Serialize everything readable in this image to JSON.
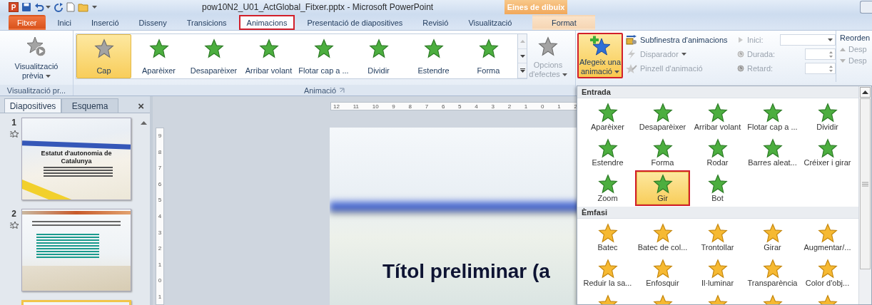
{
  "window": {
    "app_letter": "P",
    "title": "pow10N2_U01_ActGlobal_Fitxer.pptx - Microsoft PowerPoint",
    "context_group": "Eines de dibuix"
  },
  "tabs": [
    {
      "label": "Fitxer",
      "kind": "file",
      "selected": false,
      "highlighted": false
    },
    {
      "label": "Inici",
      "kind": "normal",
      "selected": false,
      "highlighted": false
    },
    {
      "label": "Inserció",
      "kind": "normal",
      "selected": false,
      "highlighted": false
    },
    {
      "label": "Disseny",
      "kind": "normal",
      "selected": false,
      "highlighted": false
    },
    {
      "label": "Transicions",
      "kind": "normal",
      "selected": false,
      "highlighted": false
    },
    {
      "label": "Animacions",
      "kind": "normal",
      "selected": true,
      "highlighted": true
    },
    {
      "label": "Presentació de diapositives",
      "kind": "normal",
      "selected": false,
      "highlighted": false
    },
    {
      "label": "Revisió",
      "kind": "normal",
      "selected": false,
      "highlighted": false
    },
    {
      "label": "Visualització",
      "kind": "normal",
      "selected": false,
      "highlighted": false
    },
    {
      "label": "Format",
      "kind": "context",
      "selected": false,
      "highlighted": false
    }
  ],
  "ribbon": {
    "preview": {
      "label_line_1": "Visualització",
      "label_line_2": "prèvia",
      "group_label": "Visualització pr..."
    },
    "gallery": {
      "group_label": "Animació",
      "items": [
        {
          "label": "Cap",
          "kind": "none",
          "selected": true
        },
        {
          "label": "Aparèixer",
          "kind": "entrance",
          "selected": false
        },
        {
          "label": "Desaparèixer",
          "kind": "entrance",
          "selected": false
        },
        {
          "label": "Arribar volant",
          "kind": "entrance",
          "selected": false
        },
        {
          "label": "Flotar cap a ...",
          "kind": "entrance",
          "selected": false
        },
        {
          "label": "Dividir",
          "kind": "entrance",
          "selected": false
        },
        {
          "label": "Estendre",
          "kind": "entrance",
          "selected": false
        },
        {
          "label": "Forma",
          "kind": "entrance",
          "selected": false
        }
      ]
    },
    "effect_options": {
      "label_line_1": "Opcions",
      "label_line_2": "d'efectes",
      "disabled": true
    },
    "add_animation": {
      "label_line_1": "Afegeix una",
      "label_line_2": "animació",
      "selected": true,
      "highlighted": true
    },
    "small_buttons": [
      {
        "label": "Subfinestra d'animacions",
        "disabled": false,
        "dropdown": false
      },
      {
        "label": "Disparador",
        "disabled": true,
        "dropdown": true
      },
      {
        "label": "Pinzell d'animació",
        "disabled": true,
        "dropdown": false
      }
    ],
    "timing": [
      {
        "label": "Inici:",
        "kind": "dropdown",
        "disabled": true
      },
      {
        "label": "Durada:",
        "kind": "spinner",
        "disabled": true
      },
      {
        "label": "Retard:",
        "kind": "spinner",
        "disabled": true
      }
    ],
    "reorder": {
      "label": "Reorden",
      "items": [
        {
          "label": "Desp",
          "kind": "up",
          "disabled": true
        },
        {
          "label": "Desp",
          "kind": "down",
          "disabled": true
        }
      ]
    }
  },
  "slides_pane": {
    "tabs": [
      {
        "label": "Diapositives",
        "selected": true
      },
      {
        "label": "Esquema",
        "selected": false
      }
    ],
    "close": "×",
    "slides": [
      {
        "number": "1",
        "kind": "title",
        "title": "Estatut d'autonomia de Catalunya",
        "has_animation": true,
        "selected": false
      },
      {
        "number": "2",
        "kind": "list",
        "has_animation": true,
        "selected": false
      },
      {
        "kind": "title",
        "has_animation": false,
        "selected": true
      }
    ]
  },
  "rulers": {
    "horizontal": [
      "12",
      "11",
      "10",
      "9",
      "8",
      "7",
      "6",
      "5",
      "4",
      "3",
      "2",
      "1",
      "0",
      "1",
      "2"
    ],
    "vertical": [
      "9",
      "8",
      "7",
      "6",
      "5",
      "4",
      "3",
      "2",
      "1",
      "0",
      "1"
    ]
  },
  "slide": {
    "title": "Títol preliminar (a"
  },
  "animation_menu": {
    "sections": [
      {
        "title": "Entrada",
        "kind": "entrance",
        "items": [
          {
            "label": "Aparèixer",
            "selected": false,
            "highlighted": false
          },
          {
            "label": "Desaparèixer",
            "selected": false,
            "highlighted": false
          },
          {
            "label": "Arribar volant",
            "selected": false,
            "highlighted": false
          },
          {
            "label": "Flotar cap a ...",
            "selected": false,
            "highlighted": false
          },
          {
            "label": "Dividir",
            "selected": false,
            "highlighted": false
          },
          {
            "label": "Estendre",
            "selected": false,
            "highlighted": false
          },
          {
            "label": "Forma",
            "selected": false,
            "highlighted": false
          },
          {
            "label": "Rodar",
            "selected": false,
            "highlighted": false
          },
          {
            "label": "Barres aleat...",
            "selected": false,
            "highlighted": false
          },
          {
            "label": "Créixer i girar",
            "selected": false,
            "highlighted": false
          },
          {
            "label": "Zoom",
            "selected": false,
            "highlighted": false
          },
          {
            "label": "Gir",
            "selected": true,
            "highlighted": true
          },
          {
            "label": "Bot",
            "selected": false,
            "highlighted": false
          }
        ]
      },
      {
        "title": "Èmfasi",
        "kind": "emphasis",
        "items": [
          {
            "label": "Batec",
            "selected": false,
            "highlighted": false
          },
          {
            "label": "Batec de col...",
            "selected": false,
            "highlighted": false
          },
          {
            "label": "Trontollar",
            "selected": false,
            "highlighted": false
          },
          {
            "label": "Girar",
            "selected": false,
            "highlighted": false
          },
          {
            "label": "Augmentar/...",
            "selected": false,
            "highlighted": false
          },
          {
            "label": "Reduir la sa...",
            "selected": false,
            "highlighted": false
          },
          {
            "label": "Enfosquir",
            "selected": false,
            "highlighted": false
          },
          {
            "label": "Il·luminar",
            "selected": false,
            "highlighted": false
          },
          {
            "label": "Transparència",
            "selected": false,
            "highlighted": false
          },
          {
            "label": "Color d'obj...",
            "selected": false,
            "highlighted": false
          },
          {
            "selected": false,
            "highlighted": false
          },
          {
            "selected": false,
            "highlighted": false
          },
          {
            "selected": false,
            "highlighted": false
          },
          {
            "selected": false,
            "highlighted": false
          },
          {
            "selected": false,
            "highlighted": false
          }
        ]
      }
    ]
  }
}
